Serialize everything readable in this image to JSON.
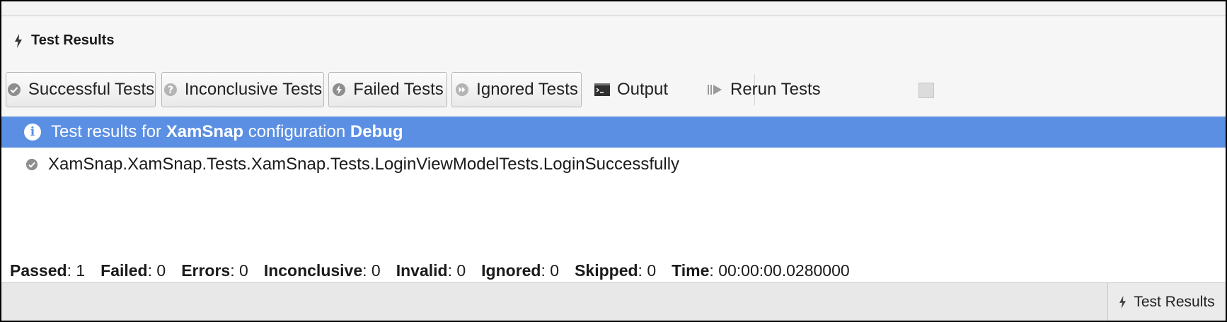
{
  "pad": {
    "title": "Test Results"
  },
  "toolbar": {
    "successful_label": "Successful Tests",
    "inconclusive_label": "Inconclusive Tests",
    "failed_label": "Failed Tests",
    "ignored_label": "Ignored Tests",
    "output_label": "Output",
    "rerun_label": "Rerun Tests"
  },
  "results": {
    "header": {
      "prefix": "Test results for ",
      "project": "XamSnap",
      "middle": " configuration ",
      "configuration": "Debug"
    },
    "tests": [
      {
        "name": "XamSnap.XamSnap.Tests.XamSnap.Tests.LoginViewModelTests.LoginSuccessfully",
        "status": "passed"
      }
    ]
  },
  "summary": {
    "passed_label": "Passed",
    "passed": "1",
    "failed_label": "Failed",
    "failed": "0",
    "errors_label": "Errors",
    "errors": "0",
    "inconclusive_label": "Inconclusive",
    "inconclusive": "0",
    "invalid_label": "Invalid",
    "invalid": "0",
    "ignored_label": "Ignored",
    "ignored": "0",
    "skipped_label": "Skipped",
    "skipped": "0",
    "time_label": "Time",
    "time": "00:00:00.0280000"
  },
  "bottom_bar": {
    "tab_label": "Test Results"
  },
  "colors": {
    "selection": "#5b8fe3",
    "status_icon": "#8e8e8e"
  }
}
